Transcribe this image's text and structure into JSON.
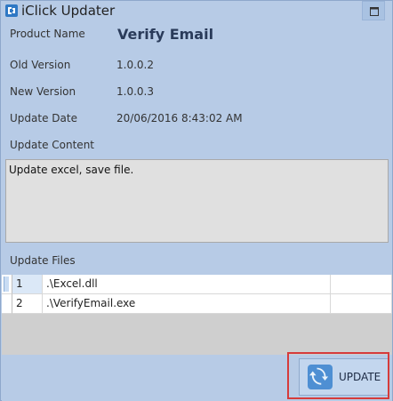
{
  "window": {
    "title": "iClick Updater"
  },
  "fields": {
    "product_name": {
      "label": "Product Name",
      "value": "Verify Email"
    },
    "old_version": {
      "label": "Old Version",
      "value": "1.0.0.2"
    },
    "new_version": {
      "label": "New Version",
      "value": "1.0.0.3"
    },
    "update_date": {
      "label": "Update Date",
      "value": "20/06/2016 8:43:02 AM"
    }
  },
  "update_content": {
    "label": "Update Content",
    "text": "Update excel, save file."
  },
  "update_files": {
    "label": "Update Files",
    "rows": [
      {
        "num": "1",
        "file": ".\\Excel.dll"
      },
      {
        "num": "2",
        "file": ".\\VerifyEmail.exe"
      }
    ]
  },
  "actions": {
    "update_label": "UPDATE"
  },
  "icons": {
    "app": "app-logo-icon",
    "maximize": "maximize-icon",
    "update": "refresh-icon"
  },
  "colors": {
    "window_bg": "#b7cbe6",
    "highlight": "#d63b3b"
  }
}
